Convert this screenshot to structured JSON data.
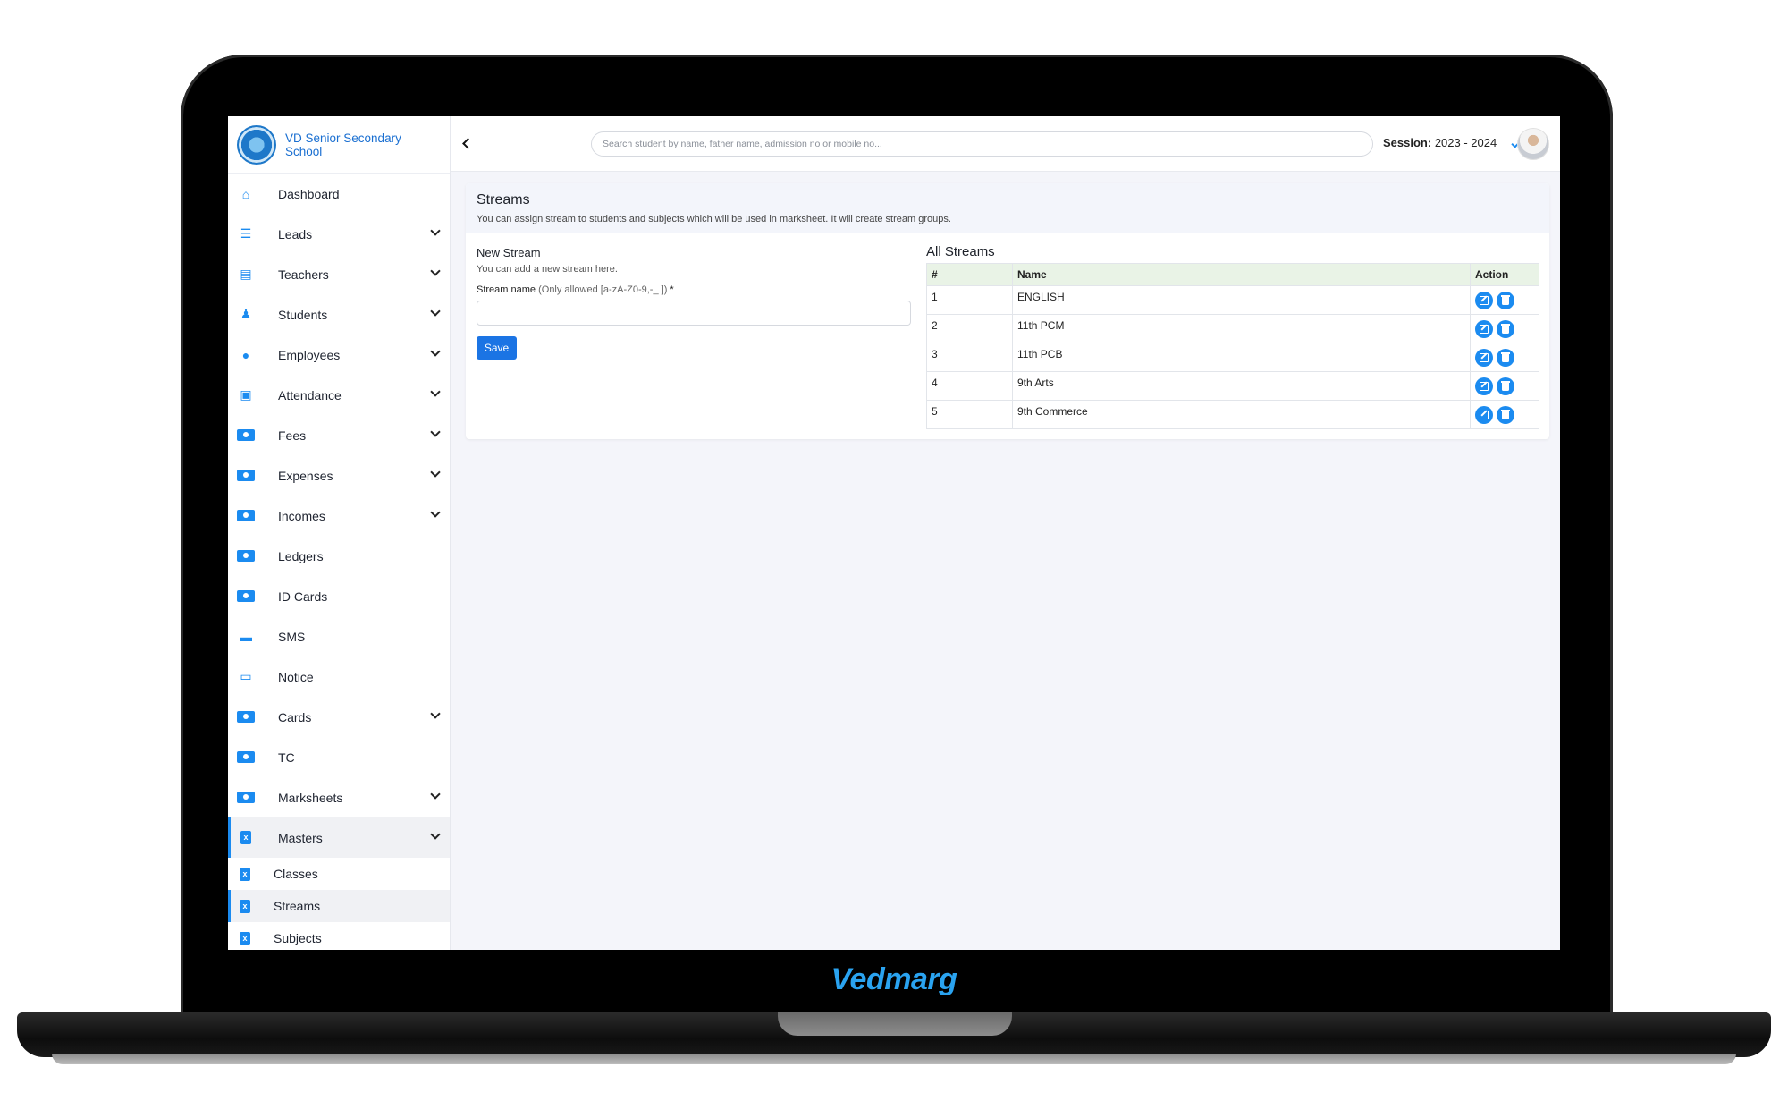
{
  "school": {
    "name": "VD Senior Secondary School"
  },
  "sidebar": {
    "items": [
      {
        "label": "Dashboard",
        "icon": "home-icon",
        "has_children": false
      },
      {
        "label": "Leads",
        "icon": "list-icon",
        "has_children": true
      },
      {
        "label": "Teachers",
        "icon": "teacher-icon",
        "has_children": true
      },
      {
        "label": "Students",
        "icon": "student-icon",
        "has_children": true
      },
      {
        "label": "Employees",
        "icon": "user-icon",
        "has_children": true
      },
      {
        "label": "Attendance",
        "icon": "attendance-icon",
        "has_children": true
      },
      {
        "label": "Fees",
        "icon": "money-icon",
        "has_children": true
      },
      {
        "label": "Expenses",
        "icon": "money-icon",
        "has_children": true
      },
      {
        "label": "Incomes",
        "icon": "money-icon",
        "has_children": true
      },
      {
        "label": "Ledgers",
        "icon": "money-icon",
        "has_children": false
      },
      {
        "label": "ID Cards",
        "icon": "id-card-icon",
        "has_children": false
      },
      {
        "label": "SMS",
        "icon": "chat-icon",
        "has_children": false
      },
      {
        "label": "Notice",
        "icon": "notice-icon",
        "has_children": false
      },
      {
        "label": "Cards",
        "icon": "id-card-icon",
        "has_children": true
      },
      {
        "label": "TC",
        "icon": "money-icon",
        "has_children": false
      },
      {
        "label": "Marksheets",
        "icon": "money-icon",
        "has_children": true
      },
      {
        "label": "Masters",
        "icon": "excel-file-icon",
        "has_children": true,
        "active": true
      }
    ],
    "sub_items": [
      {
        "label": "Classes"
      },
      {
        "label": "Streams",
        "active": true
      },
      {
        "label": "Subjects"
      }
    ]
  },
  "topbar": {
    "search_placeholder": "Search student by name, father name, admission no or mobile no...",
    "session_label": "Session:",
    "session_value": "2023 - 2024"
  },
  "page": {
    "title": "Streams",
    "description": "You can assign stream to students and subjects which will be used in marksheet. It will create stream groups."
  },
  "form": {
    "title": "New Stream",
    "subtitle": "You can add a new stream here.",
    "field_label": "Stream name",
    "field_hint": "(Only allowed [a-zA-Z0-9,-_ ])",
    "required_mark": "*",
    "save_label": "Save"
  },
  "table": {
    "title": "All Streams",
    "headers": [
      "#",
      "Name",
      "Action"
    ],
    "rows": [
      {
        "num": "1",
        "name": "ENGLISH"
      },
      {
        "num": "2",
        "name": "11th PCM"
      },
      {
        "num": "3",
        "name": "11th PCB"
      },
      {
        "num": "4",
        "name": "9th Arts"
      },
      {
        "num": "5",
        "name": "9th Commerce"
      }
    ]
  },
  "footer": {
    "brand": "Vedmarg"
  },
  "colors": {
    "accent": "#1b8bf0",
    "primary_button": "#1b74e4",
    "table_header_bg": "#e9f3e6"
  }
}
